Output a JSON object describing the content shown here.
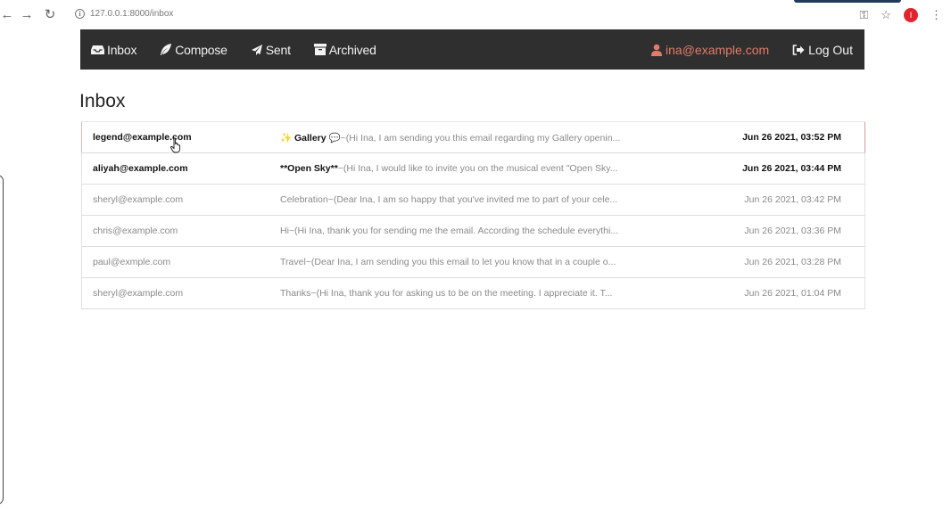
{
  "browser": {
    "url": "127.0.0.1:8000/inbox",
    "profile_initial": "I"
  },
  "navbar": {
    "items": [
      {
        "label": "Inbox",
        "icon": "inbox-icon"
      },
      {
        "label": "Compose",
        "icon": "feather-icon"
      },
      {
        "label": "Sent",
        "icon": "send-icon"
      },
      {
        "label": "Archived",
        "icon": "archive-icon"
      }
    ],
    "user": "ina@example.com",
    "logout": "Log Out"
  },
  "page": {
    "title": "Inbox"
  },
  "emails": [
    {
      "sender": "legend@example.com",
      "subject": "✨ Gallery 💬",
      "preview": "~(Hi Ina, I am sending you this email regarding my Gallery openin...",
      "timestamp": "Jun 26 2021, 03:52 PM",
      "read": false
    },
    {
      "sender": "aliyah@example.com",
      "subject": "**Open Sky**",
      "preview": "~(Hi Ina, I would like to invite you on the musical event \"Open Sky...",
      "timestamp": "Jun 26 2021, 03:44 PM",
      "read": false
    },
    {
      "sender": "sheryl@example.com",
      "subject": "Celebration",
      "preview": "~(Dear Ina, I am so happy that you've invited me to part of your cele...",
      "timestamp": "Jun 26 2021, 03:42 PM",
      "read": true
    },
    {
      "sender": "chris@example.com",
      "subject": "Hi",
      "preview": "~(Hi Ina, thank you for sending me the email. According the schedule everythi...",
      "timestamp": "Jun 26 2021, 03:36 PM",
      "read": true
    },
    {
      "sender": "paul@exmple.com",
      "subject": "Travel",
      "preview": "~(Dear Ina, I am sending you this email to let you know that in a couple o...",
      "timestamp": "Jun 26 2021, 03:28 PM",
      "read": true
    },
    {
      "sender": "sheryl@example.com",
      "subject": "Thanks",
      "preview": "~(Hi Ina, thank you for asking us to be on the meeting. I appreciate it. T...",
      "timestamp": "Jun 26 2021, 01:04 PM",
      "read": true
    }
  ],
  "colors": {
    "navbar_bg": "#2f2f2f",
    "user_accent": "#e27b69",
    "profile_badge": "#e0252f"
  }
}
